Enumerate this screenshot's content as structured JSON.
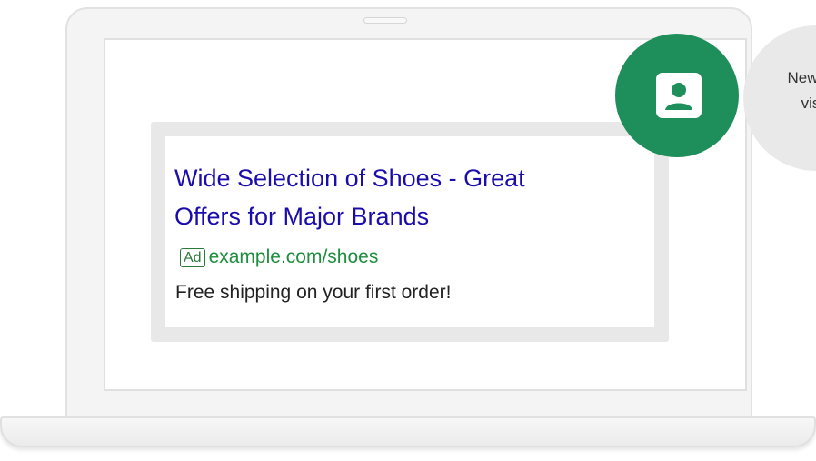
{
  "ad": {
    "headline_line1": "Wide Selection of Shoes - Great",
    "headline_line2": "Offers for Major Brands",
    "badge": "Ad",
    "display_url": "example.com/shoes",
    "description": "Free shipping on your first order!"
  },
  "callout": {
    "line1": "New w",
    "line2": "vis",
    "icon": "account-box-icon"
  },
  "colors": {
    "headline": "#1a0dab",
    "url": "#1e8e3e",
    "badge_circle": "#1e8e5a",
    "ad_frame": "#e8e8e8",
    "bubble": "#e9e9e9"
  }
}
